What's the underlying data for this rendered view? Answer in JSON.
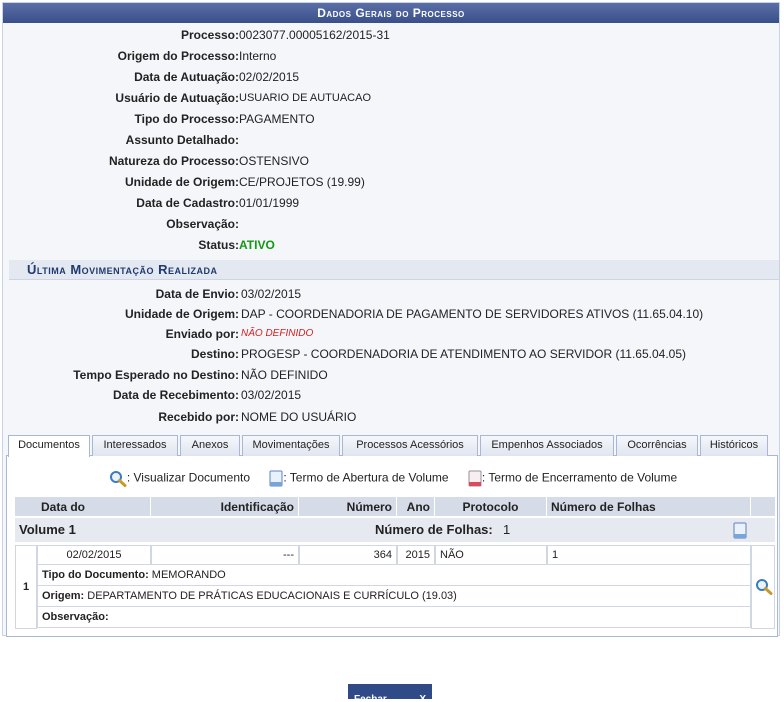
{
  "header": {
    "title": "Dados Gerais do Processo"
  },
  "general": [
    {
      "label": "Processo:",
      "value": "0023077.00005162/2015-31"
    },
    {
      "label": "Origem do Processo:",
      "value": "Interno"
    },
    {
      "label": "Data de Autuação:",
      "value": "02/02/2015"
    },
    {
      "label": "Usuário de Autuação:",
      "value": "USUARIO DE AUTUACAO"
    },
    {
      "label": "Tipo do Processo:",
      "value": "PAGAMENTO"
    },
    {
      "label": "Assunto Detalhado:",
      "value": ""
    },
    {
      "label": "Natureza do Processo:",
      "value": "OSTENSIVO"
    },
    {
      "label": "Unidade de Origem:",
      "value": "CE/PROJETOS (19.99)"
    },
    {
      "label": "Data de Cadastro:",
      "value": "01/01/1999"
    },
    {
      "label": "Observação:",
      "value": ""
    },
    {
      "label": "Status:",
      "value": "ATIVO"
    }
  ],
  "movement": {
    "title": "Última Movimentação Realizada",
    "rows": [
      {
        "label": "Data de Envio:",
        "value": "03/02/2015"
      },
      {
        "label": "Unidade de Origem:",
        "value": "DAP - COORDENADORIA DE PAGAMENTO DE SERVIDORES ATIVOS (11.65.04.10)"
      },
      {
        "label": "Enviado por:",
        "value": "NÃO DEFINIDO"
      },
      {
        "label": "Destino:",
        "value": "PROGESP - COORDENADORIA DE ATENDIMENTO AO SERVIDOR (11.65.04.05)"
      },
      {
        "label": "Tempo Esperado no Destino:",
        "value": "NÃO DEFINIDO"
      },
      {
        "label": "Data de Recebimento:",
        "value": "03/02/2015"
      },
      {
        "label": "Recebido por:",
        "value": "NOME DO USUÁRIO"
      }
    ]
  },
  "tabs": [
    "Documentos",
    "Interessados",
    "Anexos",
    "Movimentações",
    "Processos Acessórios",
    "Empenhos Associados",
    "Ocorrências",
    "Históricos"
  ],
  "legend": {
    "view": ": Visualizar Documento",
    "open_term": ": Termo de Abertura de Volume",
    "close_term": ": Termo de Encerramento de Volume"
  },
  "table": {
    "headers": [
      "Data do Documento",
      "Identificação",
      "Número",
      "Ano",
      "Protocolo",
      "Número de Folhas"
    ],
    "volume": {
      "label": "Volume 1",
      "pages_label": "Número de Folhas:",
      "pages": "1"
    },
    "document": {
      "index": "1",
      "date": "02/02/2015",
      "identification": "---",
      "number": "364",
      "year": "2015",
      "protocol": "NÃO PROTOCOLADO",
      "pages": "1",
      "type_label": "Tipo do Documento:",
      "type": "MEMORANDO",
      "origin_label": "Origem:",
      "origin": "DEPARTAMENTO DE PRÁTICAS EDUCACIONAIS E CURRÍCULO (19.03)",
      "obs_label": "Observação:",
      "obs": ""
    }
  },
  "footer": {
    "close_label": "Fechar",
    "close_x": "X"
  },
  "colors": {
    "header": "#3a4f8a",
    "status_active": "#119911",
    "not_defined": "#d42020"
  }
}
